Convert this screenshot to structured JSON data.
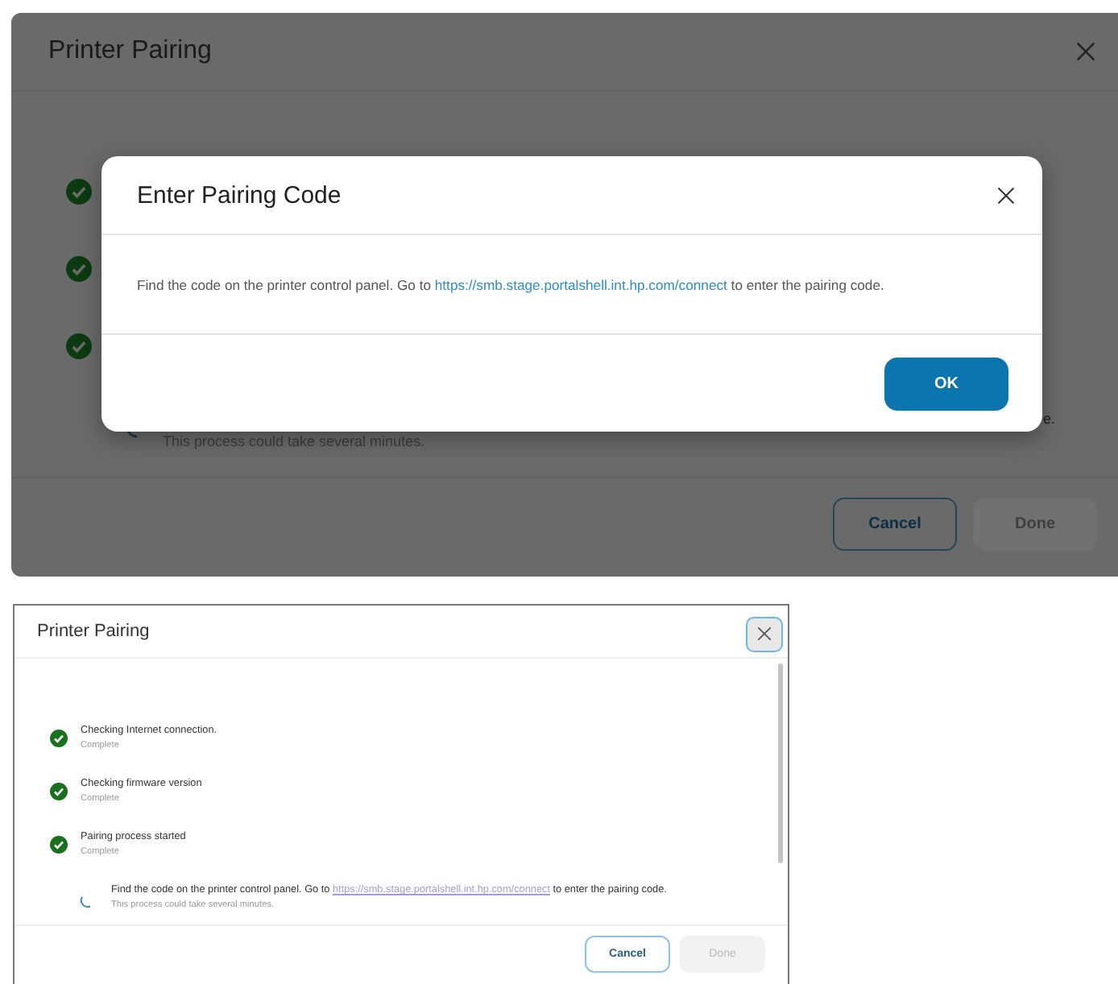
{
  "top_view": {
    "background_dialog": {
      "title": "Printer Pairing",
      "steps": [
        {
          "kind": "done"
        },
        {
          "kind": "done"
        },
        {
          "kind": "done"
        },
        {
          "kind": "progress",
          "text_tail": "e.",
          "hint": "This process could take several minutes."
        }
      ],
      "buttons": [
        {
          "label": "Cancel",
          "disabled": false
        },
        {
          "label": "Done",
          "disabled": true
        }
      ]
    },
    "modal": {
      "title": "Enter Pairing Code",
      "message_before": "Find the code on the printer control panel. Go to",
      "link": "https://smb.stage.portalshell.int.hp.com/connect",
      "message_after": "to enter the pairing code.",
      "button": "OK"
    }
  },
  "bottom_view": {
    "dialog": {
      "title": "Printer Pairing",
      "steps": [
        {
          "kind": "done",
          "text": "Checking Internet connection.",
          "hint": "Complete"
        },
        {
          "kind": "done",
          "text": "Checking firmware version",
          "hint": "Complete"
        },
        {
          "kind": "done",
          "text": "Pairing process started",
          "hint": "Complete"
        },
        {
          "kind": "progress",
          "text_before": "Find the code on the printer control panel. Go to",
          "link": "https://smb.stage.portalshell.int.hp.com/connect",
          "text_after": "to enter the pairing code.",
          "hint": "This process could take several minutes."
        }
      ],
      "buttons": [
        {
          "label": "Cancel",
          "disabled": false
        },
        {
          "label": "Done",
          "disabled": true
        }
      ]
    }
  }
}
